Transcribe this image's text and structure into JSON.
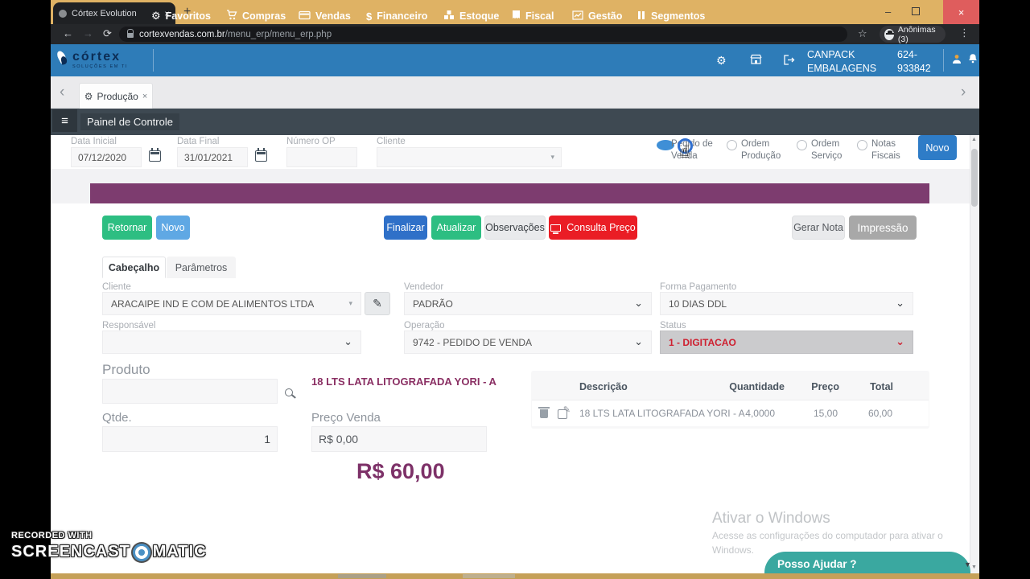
{
  "browser": {
    "tab_title": "Córtex Evolution",
    "url_domain": "cortexvendas.com.br",
    "url_path": "/menu_erp/menu_erp.php",
    "profile_label": "Anônimas (3)"
  },
  "icons": {
    "back": "←",
    "forward": "→",
    "reload": "⟳",
    "plus": "+",
    "close": "×",
    "star": "☆",
    "dots": "⋮",
    "minimize": "–",
    "gear": "⚙",
    "hamburger": "≡",
    "chevron_left": "‹",
    "chevron_right": "›",
    "caret_down": "▾",
    "select_chevron": "⌄",
    "pencil": "✎",
    "dollar": "$",
    "hand": "☝",
    "up_arrow": "▲",
    "down_arrow": "▼"
  },
  "navbar": {
    "logo_title": "córtex",
    "logo_subtitle": "SOLUÇÕES EM TI",
    "items": [
      {
        "label": "Favoritos"
      },
      {
        "label": "Compras"
      },
      {
        "label": "Vendas"
      },
      {
        "label": "Financeiro"
      },
      {
        "label": "Estoque"
      },
      {
        "label": "Fiscal"
      },
      {
        "label": "Gestão"
      },
      {
        "label": "Segmentos"
      }
    ],
    "company_line1": "CANPACK",
    "company_line2": "EMBALAGENS",
    "code_line1": "624-",
    "code_line2": "933842"
  },
  "workspace": {
    "tab_label": "Produção",
    "panel_title": "Painel de Controle"
  },
  "filters": {
    "data_inicial": {
      "label": "Data Inicial",
      "value": "07/12/2020"
    },
    "data_final": {
      "label": "Data Final",
      "value": "31/01/2021"
    },
    "numero_op": {
      "label": "Número OP",
      "value": ""
    },
    "cliente": {
      "label": "Cliente",
      "value": ""
    },
    "radios": [
      {
        "label1": "Pedido de",
        "label2": "Venda",
        "selected": true
      },
      {
        "label1": "Ordem",
        "label2": "Produção",
        "selected": false
      },
      {
        "label1": "Ordem",
        "label2": "Serviço",
        "selected": false
      },
      {
        "label1": "Notas",
        "label2": "Fiscais",
        "selected": false
      }
    ],
    "novo_label": "Novo"
  },
  "actions": {
    "retornar": "Retornar",
    "novo": "Novo",
    "finalizar": "Finalizar",
    "atualizar": "Atualizar",
    "observacoes": "Observações",
    "consulta_preco": "Consulta Preço",
    "gerar_nota": "Gerar Nota",
    "impressao": "Impressão"
  },
  "form": {
    "tabs": [
      {
        "label": "Cabeçalho"
      },
      {
        "label": "Parâmetros"
      }
    ],
    "cliente": {
      "label": "Cliente",
      "value": "ARACAIPE IND E COM DE ALIMENTOS LTDA"
    },
    "vendedor": {
      "label": "Vendedor",
      "value": "PADRÃO"
    },
    "forma_pagamento": {
      "label": "Forma Pagamento",
      "value": "10 DIAS DDL"
    },
    "responsavel": {
      "label": "Responsável",
      "value": ""
    },
    "operacao": {
      "label": "Operação",
      "value": "9742 - PEDIDO DE VENDA"
    },
    "status": {
      "label": "Status",
      "value": "1 - DIGITACAO"
    }
  },
  "produto": {
    "label": "Produto",
    "selected_name": "18 LTS LATA LITOGRAFADA YORI - A",
    "qtde_label": "Qtde.",
    "qtde_value": "1",
    "preco_label": "Preço Venda",
    "preco_value": "R$ 0,00",
    "total": "R$ 60,00"
  },
  "items_table": {
    "headers": [
      "Descrição",
      "Quantidade",
      "Preço",
      "Total"
    ],
    "rows": [
      {
        "descricao": "18 LTS LATA LITOGRAFADA YORI - A",
        "quantidade": "4,0000",
        "preco": "15,00",
        "total": "60,00"
      }
    ]
  },
  "overlays": {
    "activate_title": "Ativar o Windows",
    "activate_sub1": "Acesse as configurações do computador para ativar o",
    "activate_sub2": "Windows.",
    "chat_label": "Posso Ajudar ?",
    "recorded_with": "RECORDED WITH",
    "screencast": "SCREENCAST",
    "matic": "MATIC"
  }
}
